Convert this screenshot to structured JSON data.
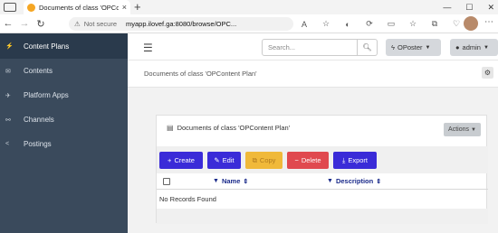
{
  "browser": {
    "tab_title": "Documents of class 'OPContent",
    "tab_close": "×",
    "new_tab": "+",
    "not_secure": "Not secure",
    "url": "myapp.ilovef.ga:8080/browse/OPC..."
  },
  "sidebar": {
    "items": [
      {
        "label": "Content Plans",
        "icon": "bolt-icon",
        "glyph": "⚡",
        "active": true
      },
      {
        "label": "Contents",
        "icon": "envelope-icon",
        "glyph": "✉",
        "active": false
      },
      {
        "label": "Platform Apps",
        "icon": "plane-icon",
        "glyph": "✈",
        "active": false
      },
      {
        "label": "Channels",
        "icon": "link-icon",
        "glyph": "🔗",
        "active": false
      },
      {
        "label": "Postings",
        "icon": "share-icon",
        "glyph": "⋖",
        "active": false
      }
    ]
  },
  "header": {
    "search_placeholder": "Search...",
    "oposter_label": "OPoster",
    "admin_label": "admin"
  },
  "page": {
    "breadcrumb": "Documents of class 'OPContent Plan'",
    "panel_title": "Documents of class 'OPContent Plan'",
    "actions_label": "Actions"
  },
  "toolbar": {
    "create": "Create",
    "edit": "Edit",
    "copy": "Copy",
    "delete": "Delete",
    "export": "Export"
  },
  "table": {
    "columns": [
      "Name",
      "Description"
    ],
    "empty_message": "No Records Found"
  },
  "colors": {
    "sidebar_bg": "#3a4a5c",
    "primary": "#3a2bd8",
    "warning": "#f0b93a",
    "danger": "#e0494f"
  }
}
